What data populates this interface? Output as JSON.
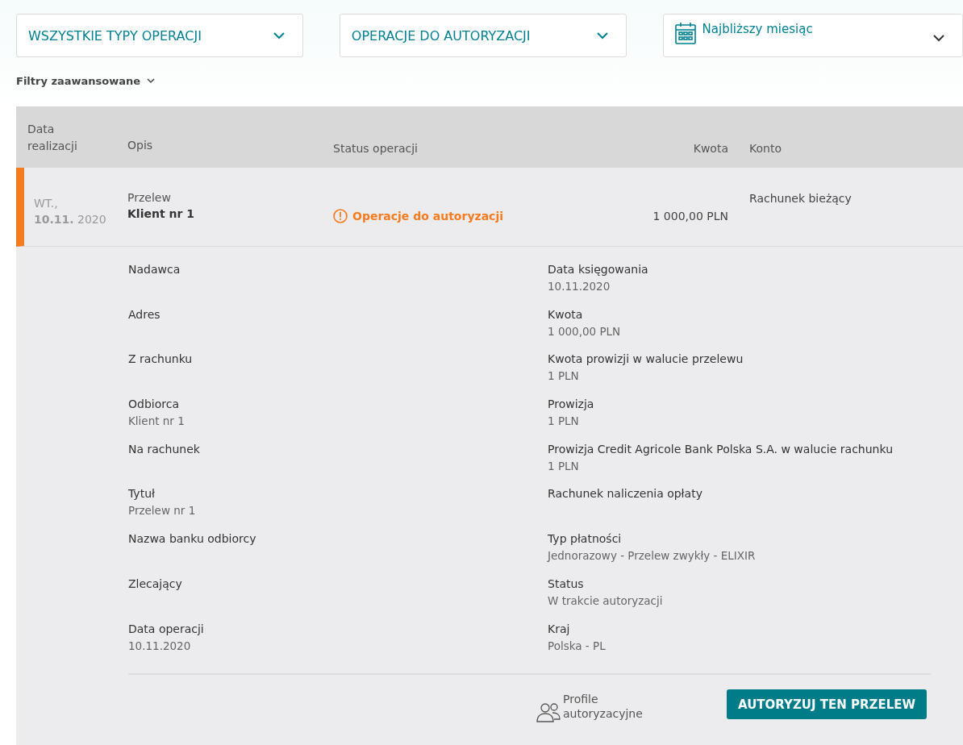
{
  "filters": [
    {
      "label": "WSZYSTKIE TYPY OPERACJI",
      "kind": "plain"
    },
    {
      "label": "OPERACJE DO AUTORYZACJI",
      "kind": "plain"
    },
    {
      "label": "Najbliższy miesiąc",
      "kind": "calendar"
    }
  ],
  "advanced_filters": {
    "label": "Filtry zaawansowane",
    "expanded": false
  },
  "table": {
    "columns": [
      "Data realizacji",
      "Opis",
      "Status operacji",
      "Kwota",
      "Konto"
    ],
    "row": {
      "day": "WT.,",
      "date": "**10.11.** 2020",
      "type": "Przelew",
      "name": "Klient nr 1",
      "status": "Operacje do autoryzacji",
      "amount": "1 000,00 PLN",
      "account": "Rachunek bieżący",
      "expanded": true,
      "color": "#f47b20"
    }
  },
  "details": {
    "left": [
      {
        "label": "Nadawca"
      },
      {
        "label": "Adres"
      },
      {
        "label": "Z rachunku"
      },
      {
        "label": "Odbiorca",
        "value": "Klient nr 1"
      },
      {
        "label": "Na rachunek"
      },
      {
        "label": "Tytuł",
        "value": "Przelew nr 1"
      },
      {
        "label": "Nazwa banku odbiorcy"
      },
      {
        "label": "Zlecający"
      },
      {
        "label": "Data operacji",
        "value": "10.11.2020"
      }
    ],
    "right": [
      {
        "label": "Data księgowania",
        "value": "10.11.2020"
      },
      {
        "label": "Kwota",
        "value": "1 000,00 PLN"
      },
      {
        "label": "Kwota prowizji w walucie przelewu",
        "value": "1 PLN"
      },
      {
        "label": "Prowizja",
        "value": "1 PLN"
      },
      {
        "label": "Prowizja Credit Agricole Bank Polska S.A. w walucie rachunku",
        "value": "1 PLN"
      },
      {
        "label": "Rachunek naliczenia opłaty"
      },
      {
        "label": "Typ płatności",
        "value": "Jednorazowy - Przelew zwykły - ELIXIR"
      },
      {
        "label": "Status",
        "value": "W trakcie autoryzacji"
      },
      {
        "label": "Kraj",
        "value": "Polska - PL"
      }
    ],
    "profiles_link": "Profile autoryzacyjne",
    "authorize_button": "AUTORYZUJ TEN PRZELEW"
  }
}
